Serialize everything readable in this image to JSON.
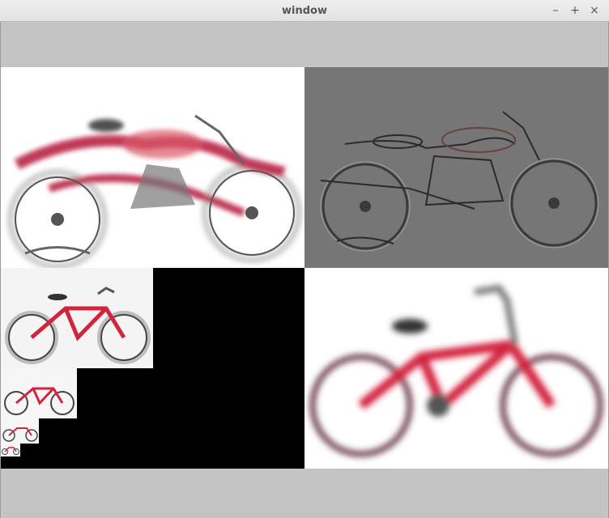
{
  "window": {
    "title": "window",
    "controls": {
      "minimize": "–",
      "maximize": "+",
      "close": "×"
    }
  },
  "panes": {
    "top_left": {
      "content": "motorcycle-enhanced-sharpened",
      "background": "#ffffff",
      "accent": "#c0183a"
    },
    "top_right": {
      "content": "motorcycle-highpass-edges",
      "background": "#767676",
      "accent": "#2a2a2a"
    },
    "bottom_left": {
      "content": "bicycle-image-pyramid",
      "background": "#000000",
      "accent": "#d3243d"
    },
    "bottom_right": {
      "content": "bicycle-blurred",
      "background": "#ffffff",
      "accent": "#d3243d"
    }
  }
}
